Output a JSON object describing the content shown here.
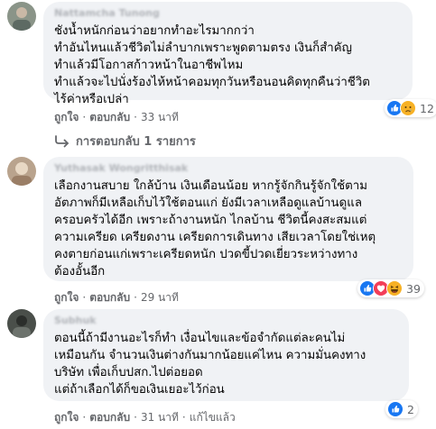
{
  "comments": [
    {
      "author": "Nattamcha Tunong",
      "lines": [
        "ชังน้ำหนักก่อนว่าอยากทำอะไรมากกว่า",
        "ทำอันไหนแล้วชีวิตไม่ลำบากเพราะพูดตามตรง เงินก็สำคัญ",
        "ทำแล้วมีโอกาสก้าวหน้าในอาชีพไหม",
        "ทำแล้วจะไปนั่งร้องไห้หน้าคอมทุกวันหรือนอนคิดทุกคืนว่าชีวิต",
        "ไร้ค่าหรือเปล่า"
      ],
      "like_label": "ถูกใจ",
      "reply_label": "ตอบกลับ",
      "time": "33 นาที",
      "reaction_count": "12",
      "reactions": [
        "like",
        "sad"
      ],
      "replies_link": "การตอบกลับ 1 รายการ"
    },
    {
      "author": "Yuthasak Wongritthisak",
      "lines": [
        "เลือกงานสบาย ใกล้บ้าน เงินเดือนน้อย หากรู้จักกินรู้จักใช้ตาม",
        "อัตภาพก็มีเหลือเก็บไว้ใช้ตอนแก่ ยังมีเวลาเหลือดูแลบ้านดูแล",
        "ครอบครัวได้อีก เพราะถ้างานหนัก ไกลบ้าน ชีวิตนี้คงสะสมแต่",
        "ความเครียด เครียดงาน เครียดการเดินทาง เสียเวลาโดยใช่เหตุ",
        "คงตายก่อนแก่เพราะเครียดหนัก ปวดขี้ปวดเยี่ยวระหว่างทาง",
        "ต้องอั้นอีก"
      ],
      "like_label": "ถูกใจ",
      "reply_label": "ตอบกลับ",
      "time": "29 นาที",
      "reaction_count": "39",
      "reactions": [
        "like",
        "love",
        "haha"
      ]
    },
    {
      "author": "Subhuk",
      "lines": [
        "ตอนนี้ถ้ามีงานอะไรก็ทำ เงื่อนไขและข้อจำกัดแต่ละคนไม่",
        "เหมือนกัน จำนวนเงินต่างกันมากน้อยแค่ไหน ความมั่นคงทาง",
        "บริษัท เพื่อเก็บปสก.ไปต่อยอด",
        "แต่ถ้าเลือกได้ก็ขอเงินเยอะไว้ก่อน"
      ],
      "like_label": "ถูกใจ",
      "reply_label": "ตอบกลับ",
      "time": "31 นาที",
      "edited_label": "แก้ไขแล้ว",
      "reaction_count": "2",
      "reactions": [
        "like"
      ]
    }
  ],
  "colors": {
    "bubble": "#f0f2f5",
    "meta_text": "#65676b",
    "like_blue": "#1877f2",
    "love_red": "#f33e58",
    "haha_yellow": "#f7b125"
  }
}
